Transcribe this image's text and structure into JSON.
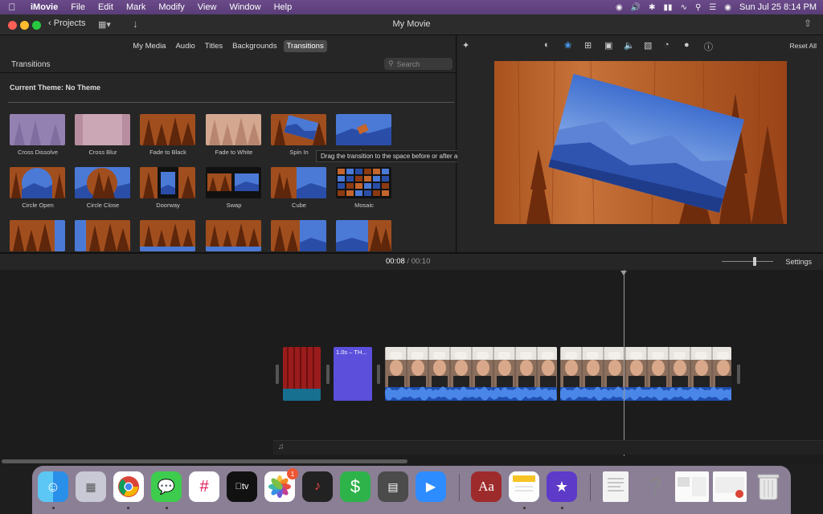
{
  "menubar": {
    "app_name": "iMovie",
    "items": [
      "File",
      "Edit",
      "Mark",
      "Modify",
      "View",
      "Window",
      "Help"
    ],
    "clock": "Sun Jul 25  8:14 PM"
  },
  "window": {
    "title": "My Movie",
    "projects_label": "Projects"
  },
  "browser": {
    "tabs": [
      "My Media",
      "Audio",
      "Titles",
      "Backgrounds",
      "Transitions"
    ],
    "active_tab": "Transitions",
    "section_title": "Transitions",
    "search_placeholder": "Search",
    "current_theme": "Current Theme: No Theme",
    "transitions": [
      {
        "label": "Cross Dissolve",
        "style": "purple"
      },
      {
        "label": "Cross Blur",
        "style": "blur"
      },
      {
        "label": "Fade to Black",
        "style": "forest-dark"
      },
      {
        "label": "Fade to White",
        "style": "forest-light"
      },
      {
        "label": "Spin In",
        "style": "spin"
      },
      {
        "label": "Spin Out",
        "style": "blue-tilt"
      },
      {
        "label": "Circle Open",
        "style": "circle-open"
      },
      {
        "label": "Circle Close",
        "style": "circle-close"
      },
      {
        "label": "Doorway",
        "style": "doorway"
      },
      {
        "label": "Swap",
        "style": "swap"
      },
      {
        "label": "Cube",
        "style": "cube"
      },
      {
        "label": "Mosaic",
        "style": "mosaic"
      },
      {
        "label": "",
        "style": "forest-blue"
      },
      {
        "label": "",
        "style": "blue-forest"
      },
      {
        "label": "",
        "style": "forest-strip"
      },
      {
        "label": "",
        "style": "forest-strip"
      },
      {
        "label": "",
        "style": "forest-blue-r"
      },
      {
        "label": "",
        "style": "blue-forest-r"
      }
    ],
    "tooltip": "Drag the transition to the space before or after a clip"
  },
  "viewer": {
    "reset_all": "Reset All",
    "tool_icons": [
      "color-balance-icon",
      "color-correction-icon",
      "crop-icon",
      "stabilization-icon",
      "volume-icon",
      "equalizer-icon",
      "speed-icon",
      "filter-icon",
      "info-icon"
    ]
  },
  "timeline": {
    "current_time": "00:08",
    "separator": "/",
    "total_time": "00:10",
    "settings_label": "Settings",
    "title_clip_label": "1.0s – TH..."
  },
  "dock": {
    "apps": [
      "Finder",
      "Launchpad",
      "Chrome",
      "Messages",
      "Slack",
      "Apple TV",
      "Photos",
      "Audio Editor",
      "Money",
      "Scanner",
      "Zoom",
      "Dictionary",
      "Notes",
      "iMovie",
      "Document",
      "Help",
      "Preview Window",
      "Chrome Window",
      "Trash"
    ],
    "photos_badge": "1"
  }
}
